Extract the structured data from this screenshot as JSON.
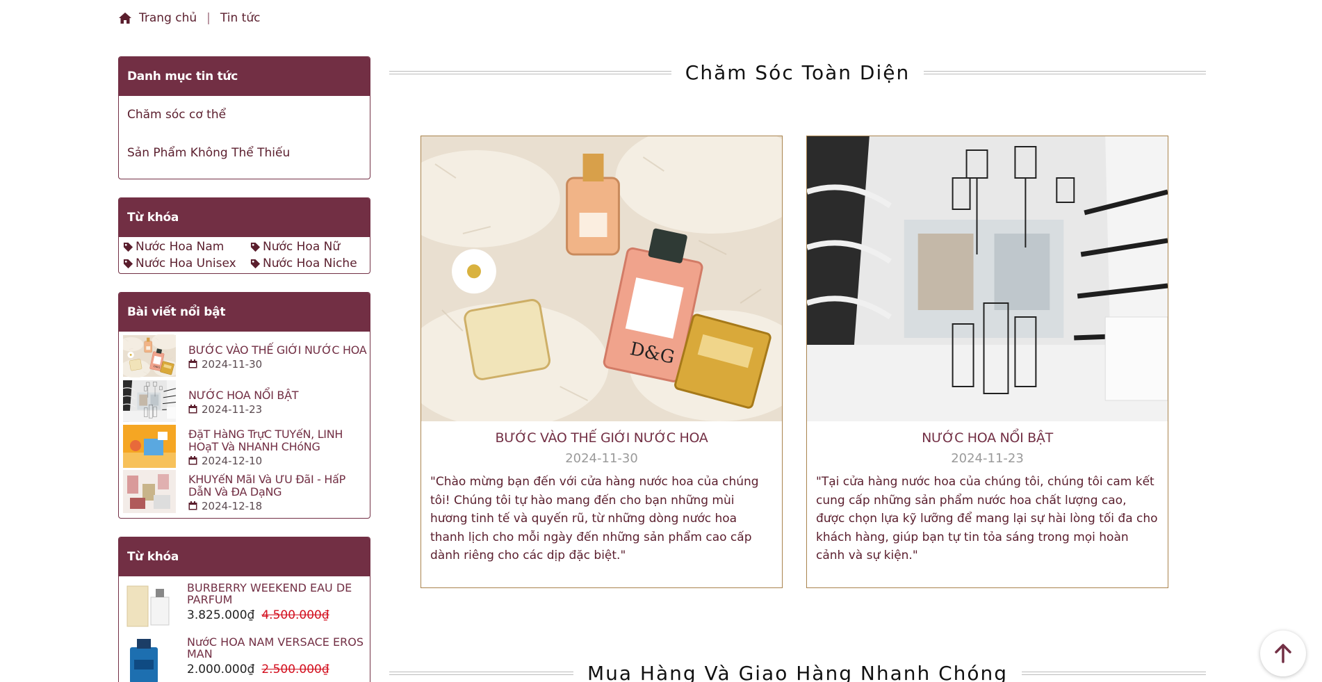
{
  "breadcrumb": {
    "home": "Trang chủ",
    "current": "Tin tức",
    "separator": "|"
  },
  "sidebar": {
    "categories": {
      "title": "Danh mục tin tức",
      "items": [
        "Chăm sóc cơ thể",
        "Sản Phẩm Không Thể Thiếu"
      ]
    },
    "keywords": {
      "title": "Từ khóa",
      "tags": [
        "Nước Hoa Nam",
        "Nước Hoa Nữ",
        "Nước Hoa Unisex",
        "Nước Hoa Niche"
      ]
    },
    "featured": {
      "title": "Bài viết nổi bật",
      "items": [
        {
          "title": "BƯỚC VÀO THẾ GIỚI NƯỚC HOA",
          "date": "2024-11-30"
        },
        {
          "title": "NƯỚC HOA NỔI BẬT",
          "date": "2024-11-23"
        },
        {
          "title": "ĐặT HàNG TrựC TUYếN, LINH HOạT Và NHANH CHóNG",
          "date": "2024-12-10"
        },
        {
          "title": "KHUYếN MãI Và ƯU ĐãI - HấP DẫN Và ĐA DạNG",
          "date": "2024-12-18"
        }
      ]
    },
    "products": {
      "title": "Từ khóa",
      "items": [
        {
          "title": "BURBERRY WEEKEND EAU DE PARFUM",
          "price": "3.825.000₫",
          "old_price": "4.500.000₫"
        },
        {
          "title": "NướC HOA NAM VERSACE EROS MAN",
          "price": "2.000.000₫",
          "old_price": "2.500.000₫"
        }
      ]
    }
  },
  "main": {
    "section1_title": "Chăm Sóc Toàn Diện",
    "section2_title": "Mua Hàng Và Giao Hàng Nhanh Chóng",
    "cards": [
      {
        "title": "BƯỚC VÀO THẾ GIỚI NƯỚC HOA",
        "date": "2024-11-30",
        "desc": "\"Chào mừng bạn đến với cửa hàng nước hoa của chúng tôi! Chúng tôi tự hào mang đến cho bạn những mùi hương tinh tế và quyến rũ, từ những dòng nước hoa thanh lịch cho mỗi ngày đến những sản phẩm cao cấp dành riêng cho các dịp đặc biệt.\""
      },
      {
        "title": "NƯỚC HOA NỔI BẬT",
        "date": "2024-11-23",
        "desc": "\"Tại cửa hàng nước hoa của chúng tôi, chúng tôi cam kết cung cấp những sản phẩm nước hoa chất lượng cao, được chọn lựa kỹ lưỡng để mang lại sự hài lòng tối đa cho khách hàng, giúp bạn tự tin tỏa sáng trong mọi hoàn cảnh và sự kiện.\""
      }
    ]
  },
  "colors": {
    "brand": "#722f44",
    "card_border": "#a9834d",
    "price_old": "#d3101f"
  },
  "icons": {
    "home": "home-icon",
    "tag": "tag-icon",
    "calendar": "calendar-icon",
    "scroll_top": "arrow-up-icon"
  }
}
